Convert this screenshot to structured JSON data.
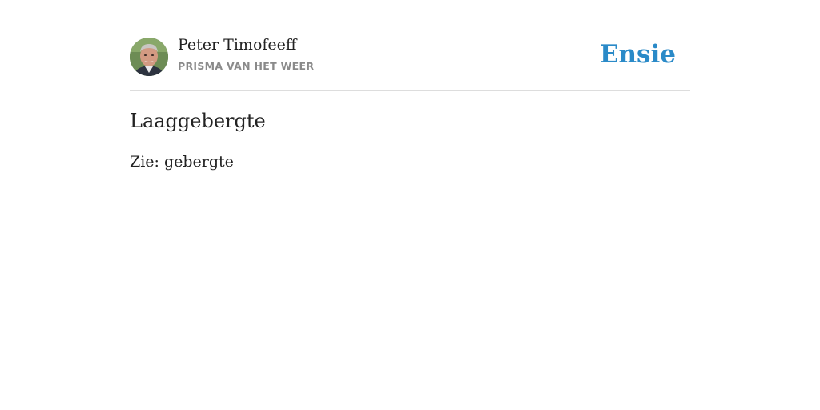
{
  "header": {
    "author_name": "Peter Timofeeff",
    "author_source": "PRISMA VAN HET WEER",
    "brand": "Ensie"
  },
  "entry": {
    "title": "Laaggebergte",
    "text": "Zie: gebergte"
  },
  "colors": {
    "brand": "#2a8ac8",
    "text": "#222222",
    "muted": "#8a8a8a",
    "divider": "#dddddd"
  }
}
